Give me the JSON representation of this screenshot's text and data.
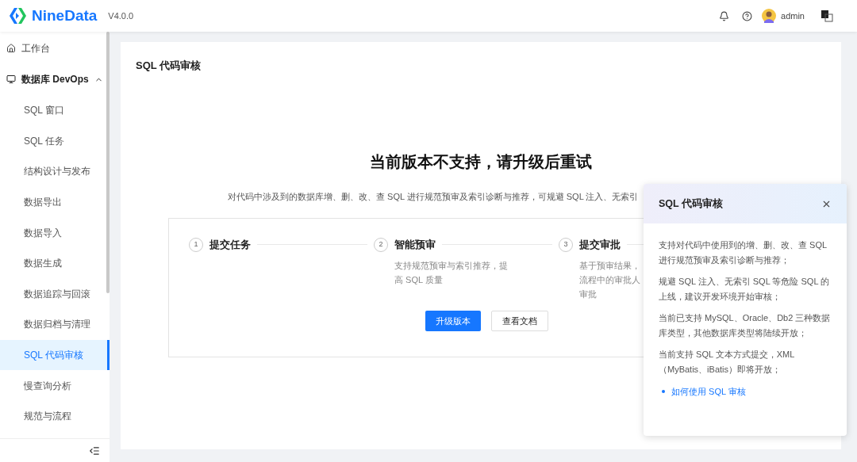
{
  "header": {
    "brand": "NineData",
    "version": "V4.0.0",
    "user": "admin"
  },
  "sidebar": {
    "items": [
      {
        "label": "工作台",
        "kind": "top",
        "selected": false
      },
      {
        "label": "数据库 DevOps",
        "kind": "group",
        "expanded": true,
        "children": [
          {
            "label": "SQL 窗口",
            "selected": false
          },
          {
            "label": "SQL 任务",
            "selected": false
          },
          {
            "label": "结构设计与发布",
            "selected": false
          },
          {
            "label": "数据导出",
            "selected": false
          },
          {
            "label": "数据导入",
            "selected": false
          },
          {
            "label": "数据生成",
            "selected": false
          },
          {
            "label": "数据追踪与回滚",
            "selected": false
          },
          {
            "label": "数据归档与清理",
            "selected": false
          },
          {
            "label": "SQL 代码审核",
            "selected": true
          },
          {
            "label": "慢查询分析",
            "selected": false
          },
          {
            "label": "规范与流程",
            "selected": false
          }
        ]
      }
    ]
  },
  "page": {
    "title": "SQL 代码审核",
    "heading": "当前版本不支持，请升级后重试",
    "description": "对代码中涉及到的数据库增、删、改、查 SQL 进行规范预审及索引诊断与推荐，可规避 SQL 注入、无索引",
    "steps": [
      {
        "number": "1",
        "title": "提交任务"
      },
      {
        "number": "2",
        "title": "智能预审",
        "desc_lines": [
          "支持规范预审与索引推荐，提",
          "高 SQL 质量"
        ]
      },
      {
        "number": "3",
        "title": "提交审批",
        "desc_lines": [
          "基于预审结果，",
          "流程中的审批人",
          "审批"
        ]
      }
    ],
    "buttons": [
      {
        "label": "升级版本",
        "kind": "primary"
      },
      {
        "label": "查看文档",
        "kind": "default"
      }
    ]
  },
  "panel": {
    "title": "SQL 代码审核",
    "paragraphs": [
      "支持对代码中使用到的增、删、改、查 SQL 进行规范预审及索引诊断与推荐；",
      "规避 SQL 注入、无索引 SQL 等危险 SQL 的上线，建议开发环境开始审核；",
      "当前已支持 MySQL、Oracle、Db2 三种数据库类型，其他数据库类型将陆续开放；",
      "当前支持 SQL 文本方式提交，XML（MyBatis、iBatis）即将开放；"
    ],
    "link": "如何使用 SQL 审核"
  }
}
